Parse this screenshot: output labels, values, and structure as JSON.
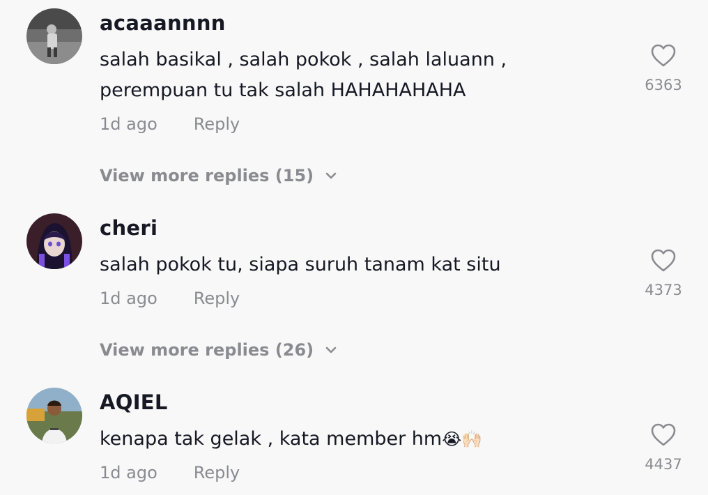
{
  "comments": [
    {
      "username": "acaaannnn",
      "text_lines": [
        "salah basikal , salah pokok , salah laluann ,",
        "perempuan tu tak salah HAHAHAHAHA"
      ],
      "time": "1d ago",
      "reply_label": "Reply",
      "likes": "6363",
      "view_more": "View more replies (15)"
    },
    {
      "username": "cheri",
      "text_lines": [
        "salah pokok tu, siapa suruh tanam kat situ"
      ],
      "time": "1d ago",
      "reply_label": "Reply",
      "likes": "4373",
      "view_more": "View more replies (26)"
    },
    {
      "username": "AQIEL",
      "text": "kenapa tak gelak , kata member hm",
      "text_emoji": "😭🙌🏻",
      "time": "1d ago",
      "reply_label": "Reply",
      "likes": "4437"
    }
  ],
  "icons": {
    "like": "heart-outline-icon",
    "expand": "chevron-down-icon"
  },
  "colors": {
    "background": "#f8f8f8",
    "primary_text": "#161823",
    "secondary_text": "#8a8b91"
  }
}
